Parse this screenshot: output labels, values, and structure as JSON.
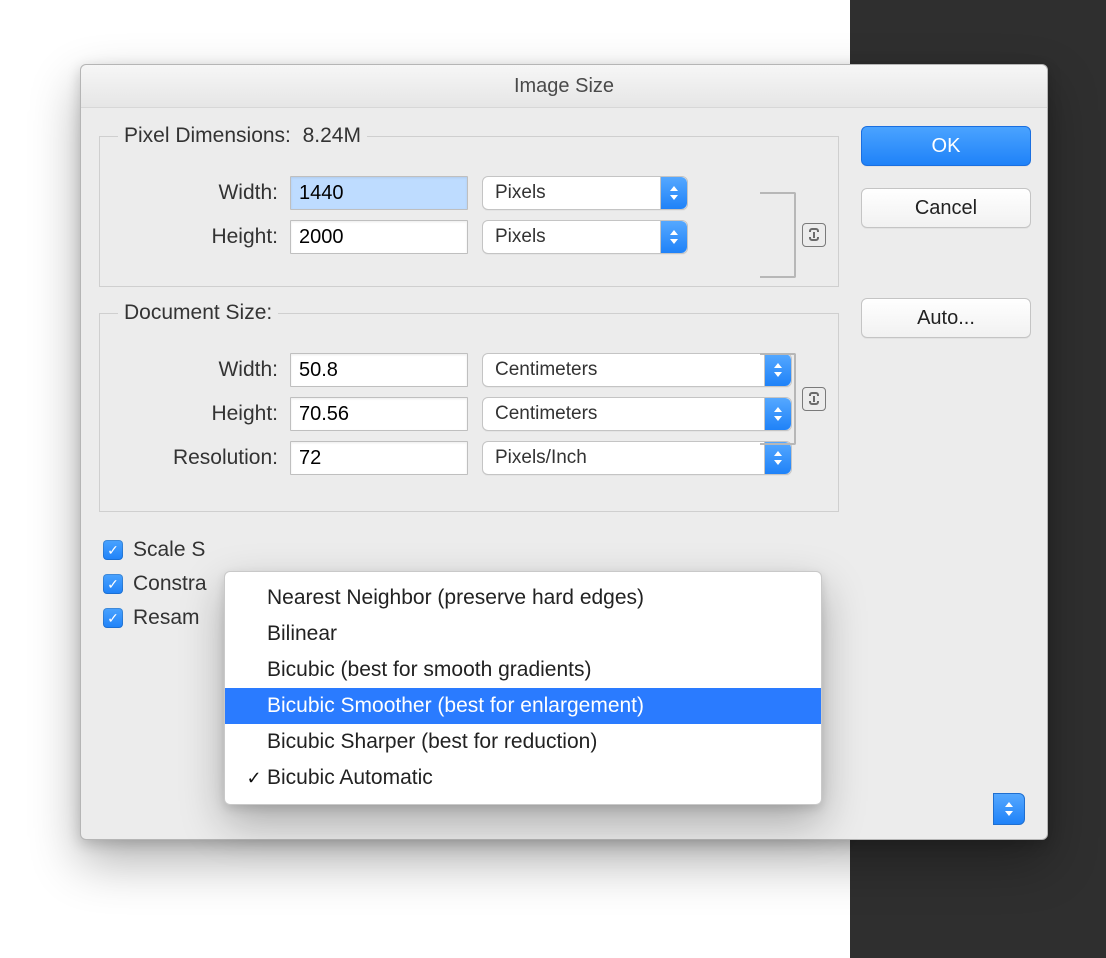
{
  "dialog": {
    "title": "Image Size",
    "buttons": {
      "ok": "OK",
      "cancel": "Cancel",
      "auto": "Auto..."
    }
  },
  "pixel_dimensions": {
    "legend": "Pixel Dimensions:",
    "size_text": "8.24M",
    "width_label": "Width:",
    "width_value": "1440",
    "width_unit": "Pixels",
    "height_label": "Height:",
    "height_value": "2000",
    "height_unit": "Pixels"
  },
  "document_size": {
    "legend": "Document Size:",
    "width_label": "Width:",
    "width_value": "50.8",
    "width_unit": "Centimeters",
    "height_label": "Height:",
    "height_value": "70.56",
    "height_unit": "Centimeters",
    "resolution_label": "Resolution:",
    "resolution_value": "72",
    "resolution_unit": "Pixels/Inch"
  },
  "checks": {
    "scale_styles": "Scale Styles",
    "constrain": "Constrain Proportions",
    "resample": "Resample Image:",
    "scale_visible": "Scale S",
    "constrain_visible": "Constra",
    "resample_visible": "Resam"
  },
  "resample_menu": {
    "items": [
      "Nearest Neighbor (preserve hard edges)",
      "Bilinear",
      "Bicubic (best for smooth gradients)",
      "Bicubic Smoother (best for enlargement)",
      "Bicubic Sharper (best for reduction)",
      "Bicubic Automatic"
    ],
    "selected_index": 3,
    "checked_index": 5
  }
}
